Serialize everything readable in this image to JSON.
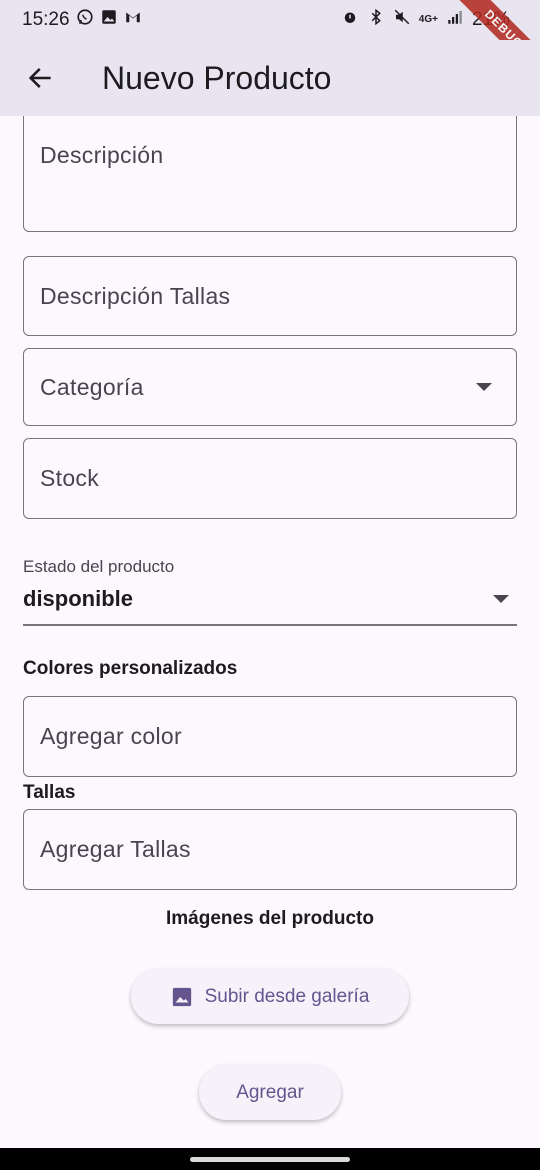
{
  "status_bar": {
    "time": "15:26",
    "battery": "21%"
  },
  "debug_banner": "DEBUG",
  "app_bar": {
    "title": "Nuevo Producto",
    "back_icon": "arrow-back-icon"
  },
  "form": {
    "descripcion_label": "Descripción",
    "descripcion_tallas_label": "Descripción Tallas",
    "categoria_label": "Categoría",
    "stock_label": "Stock",
    "estado_label": "Estado del producto",
    "estado_value": "disponible",
    "colores_title": "Colores personalizados",
    "agregar_color_label": "Agregar color",
    "tallas_title": "Tallas",
    "agregar_tallas_label": "Agregar Tallas",
    "imagenes_title": "Imágenes del producto",
    "subir_galeria_label": "Subir desde galería",
    "agregar_button_label": "Agregar"
  },
  "colors": {
    "accent": "#65558f",
    "app_bar_bg": "#e8e4f0",
    "page_bg": "#fdf7fe",
    "outline": "#79747e"
  }
}
